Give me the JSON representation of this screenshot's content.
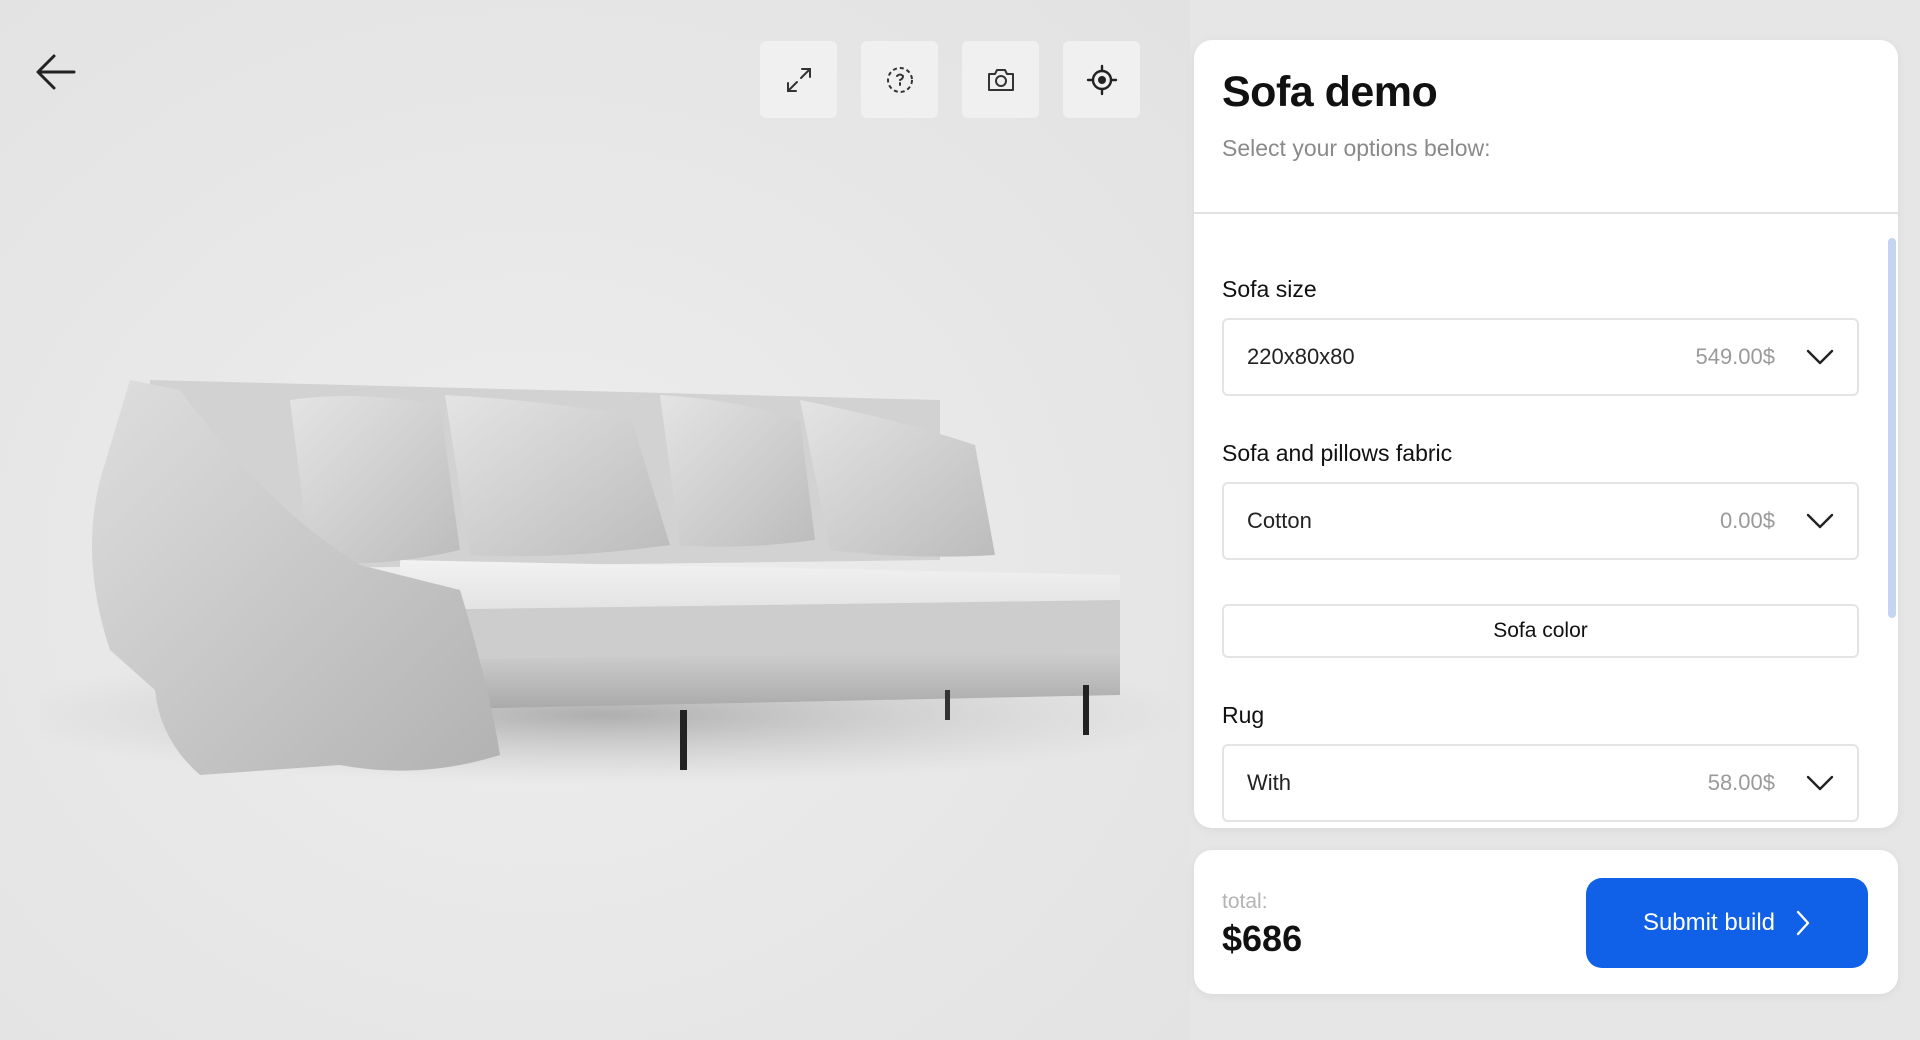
{
  "viewer": {
    "back_icon": "arrow-left-icon",
    "toolbar": [
      {
        "icon": "expand-icon"
      },
      {
        "icon": "rotate-360-icon"
      },
      {
        "icon": "camera-icon"
      },
      {
        "icon": "target-icon"
      }
    ]
  },
  "panel": {
    "title": "Sofa demo",
    "subtitle": "Select your options below:",
    "options": {
      "size": {
        "label": "Sofa size",
        "value": "220x80x80",
        "price": "549.00$"
      },
      "fabric": {
        "label": "Sofa and pillows fabric",
        "value": "Cotton",
        "price": "0.00$"
      },
      "color_button": "Sofa color",
      "rug": {
        "label": "Rug",
        "value": "With",
        "price": "58.00$"
      }
    }
  },
  "footer": {
    "total_label": "total:",
    "total_value": "$686",
    "submit_label": "Submit build"
  },
  "colors": {
    "accent": "#1060e8",
    "scrollbar": "#c6d4f3",
    "background": "#e6e6e6"
  }
}
